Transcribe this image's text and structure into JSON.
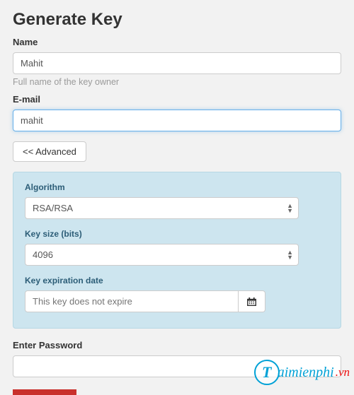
{
  "page": {
    "title": "Generate Key"
  },
  "name": {
    "label": "Name",
    "value": "Mahit",
    "help": "Full name of the key owner"
  },
  "email": {
    "label": "E-mail",
    "value": "mahit"
  },
  "advanced_button": "<< Advanced",
  "algorithm": {
    "label": "Algorithm",
    "value": "RSA/RSA"
  },
  "keysize": {
    "label": "Key size (bits)",
    "value": "4096"
  },
  "expiration": {
    "label": "Key expiration date",
    "placeholder": "This key does not expire"
  },
  "password": {
    "label": "Enter Password",
    "value": ""
  },
  "watermark": {
    "initial": "T",
    "text": "aimienphi",
    "suffix": ".vn"
  }
}
